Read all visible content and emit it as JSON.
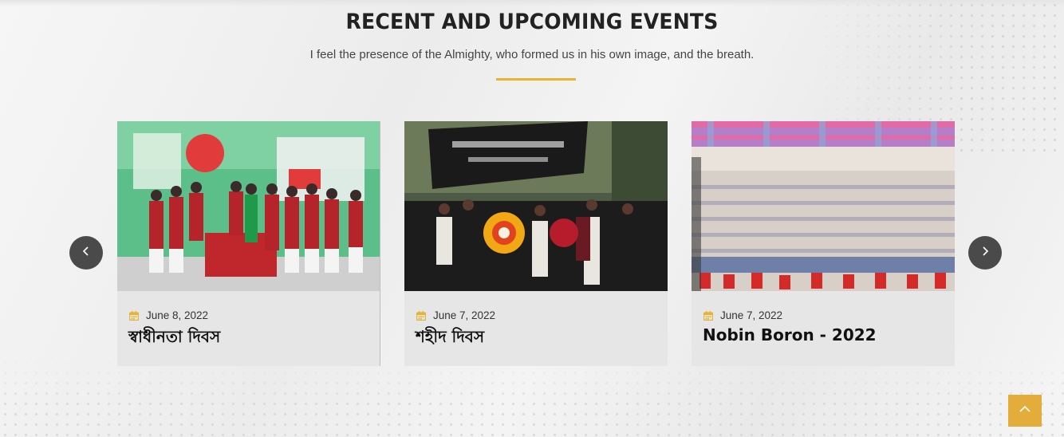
{
  "section": {
    "title": "RECENT AND UPCOMING EVENTS",
    "subtitle": "I feel the presence of the Almighty, who formed us in his own image, and the breath."
  },
  "events": [
    {
      "date": "June 8, 2022",
      "title": "স্বাধীনতা দিবস"
    },
    {
      "date": "June 7, 2022",
      "title": "শহীদ দিবস"
    },
    {
      "date": "June 7, 2022",
      "title": "Nobin Boron - 2022"
    }
  ],
  "icons": {
    "date": "calendar-icon",
    "prev": "chevron-left-icon",
    "next": "chevron-right-icon",
    "top": "chevron-up-icon"
  },
  "colors": {
    "accent": "#e8b333",
    "arrow_bg": "#4a4a4a",
    "card_bg": "#e6e6e6",
    "title": "#222222"
  }
}
